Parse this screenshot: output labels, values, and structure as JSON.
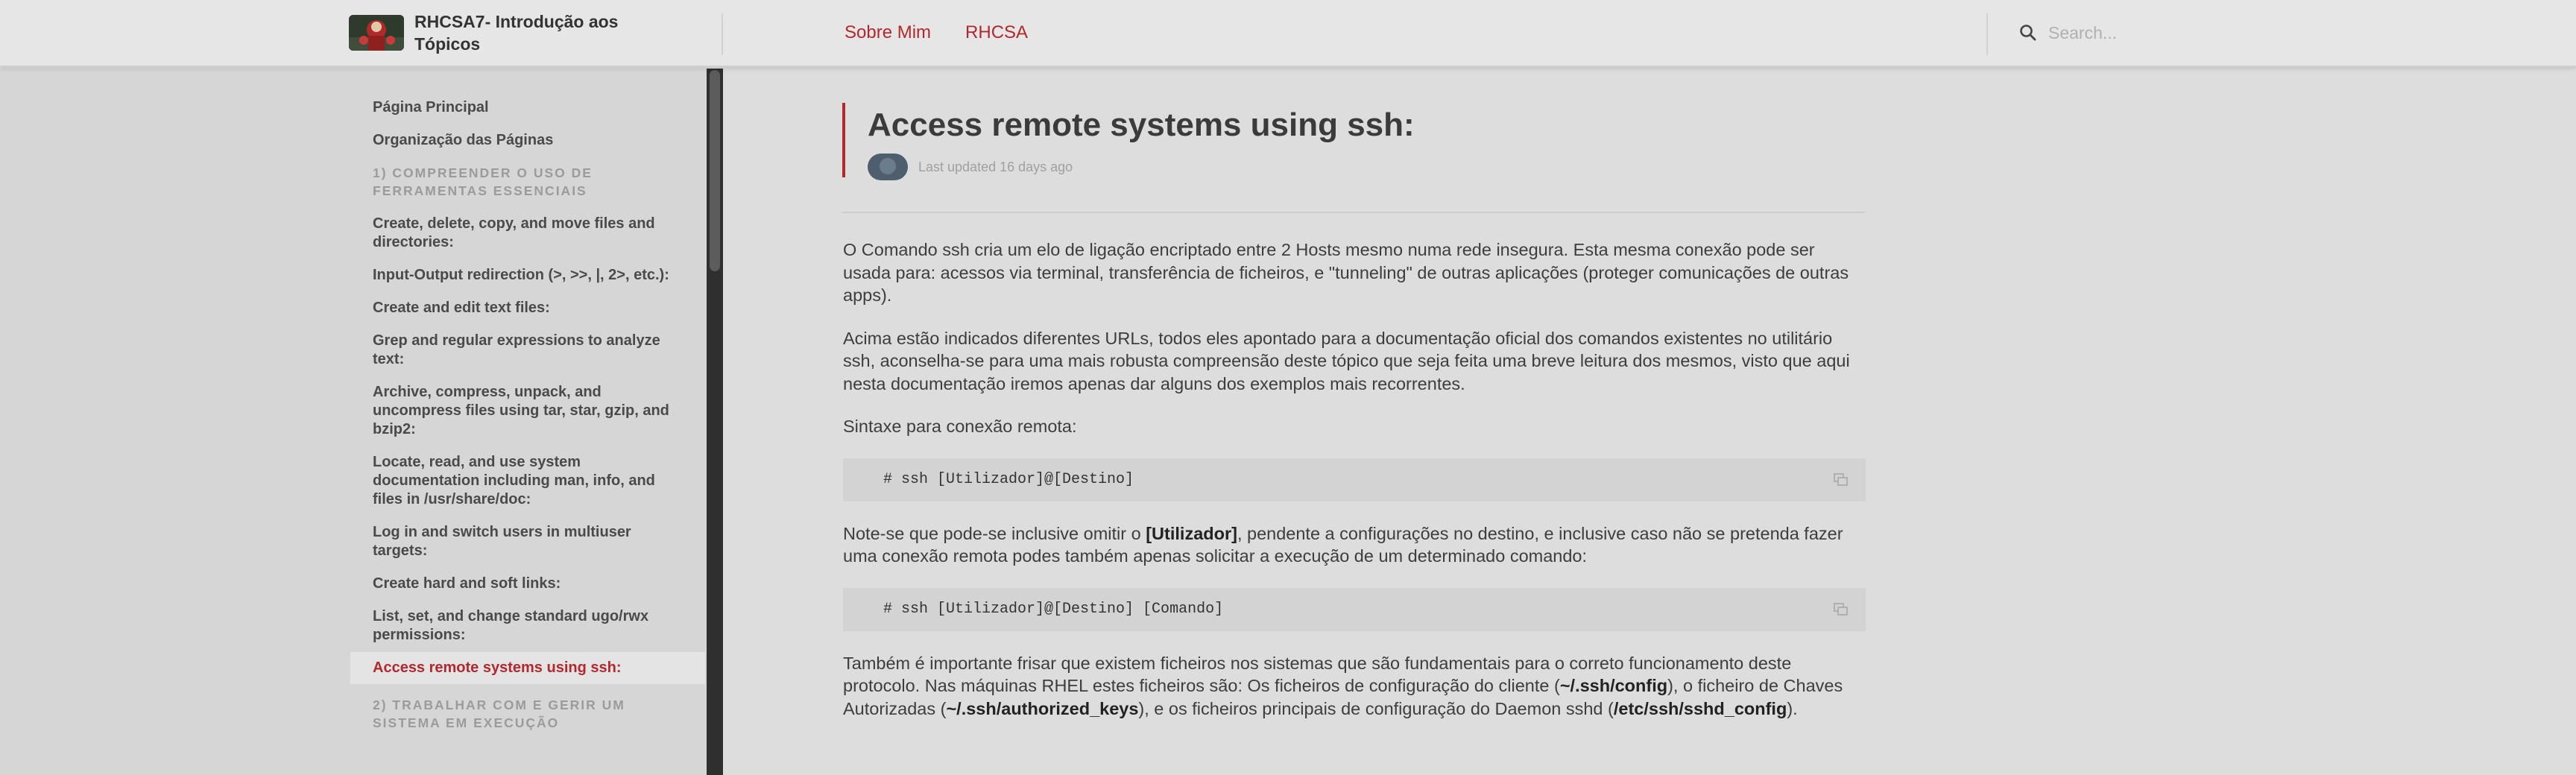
{
  "header": {
    "site_title": "RHCSA7- Introdução aos Tópicos",
    "nav": [
      "Sobre Mim",
      "RHCSA"
    ],
    "search_placeholder": "Search..."
  },
  "sidebar": {
    "items": [
      {
        "type": "link",
        "label": "Página Principal"
      },
      {
        "type": "link",
        "label": "Organização das Páginas"
      },
      {
        "type": "section",
        "label": "1) COMPREENDER O USO DE FERRAMENTAS ESSENCIAIS"
      },
      {
        "type": "link",
        "label": "Create, delete, copy, and move files and directories:"
      },
      {
        "type": "link",
        "label": "Input-Output redirection (>, >>, |, 2>, etc.):"
      },
      {
        "type": "link",
        "label": "Create and edit text files:"
      },
      {
        "type": "link",
        "label": "Grep and regular expressions to analyze text:"
      },
      {
        "type": "link",
        "label": "Archive, compress, unpack, and uncompress files using tar, star, gzip, and bzip2:"
      },
      {
        "type": "link",
        "label": "Locate, read, and use system documentation including man, info, and files in /usr/share/doc:"
      },
      {
        "type": "link",
        "label": "Log in and switch users in multiuser targets:"
      },
      {
        "type": "link",
        "label": "Create hard and soft links:"
      },
      {
        "type": "link",
        "label": "List, set, and change standard ugo/rwx permissions:"
      },
      {
        "type": "link",
        "label": "Access remote systems using ssh:",
        "active": true
      },
      {
        "type": "section",
        "label": "2) TRABALHAR COM E GERIR UM SISTEMA EM EXECUÇÃO"
      }
    ]
  },
  "page": {
    "title": "Access remote systems using ssh:",
    "last_updated": "Last updated 16 days ago"
  },
  "content": {
    "p1": "O Comando ssh cria um elo de ligação encriptado entre 2 Hosts mesmo numa rede insegura. Esta mesma conexão pode ser usada para: acessos via terminal, transferência de ficheiros, e \"tunneling\" de outras aplicações (proteger comunicações de outras apps).",
    "p2": "Acima estão indicados diferentes URLs, todos eles apontado para a documentação oficial dos comandos existentes no utilitário ssh, aconselha-se para uma mais robusta compreensão deste tópico que seja feita uma breve leitura dos mesmos, visto que aqui nesta documentação iremos apenas dar alguns dos exemplos mais recorrentes.",
    "p3": "Sintaxe para conexão remota:",
    "code1": "# ssh [Utilizador]@[Destino]",
    "p4_pre": "Note-se que pode-se inclusive omitir o ",
    "p4_bold": "[Utilizador]",
    "p4_post": ", pendente a configurações no destino, e inclusive caso não se pretenda fazer uma conexão remota podes também apenas solicitar a execução de um determinado comando:",
    "code2": "# ssh [Utilizador]@[Destino] [Comando]",
    "p5_a": "Também é importante frisar que existem ficheiros nos sistemas que são fundamentais para o correto funcionamento deste protocolo. Nas máquinas RHEL estes ficheiros são: Os ficheiros de configuração do cliente (",
    "p5_b1": "~/.ssh/config",
    "p5_c": "), o ficheiro de Chaves Autorizadas (",
    "p5_b2": "~/.ssh/authorized_keys",
    "p5_d": "), e os ficheiros principais de configuração do Daemon sshd (",
    "p5_b3": "/etc/ssh/sshd_config",
    "p5_e": ")."
  }
}
